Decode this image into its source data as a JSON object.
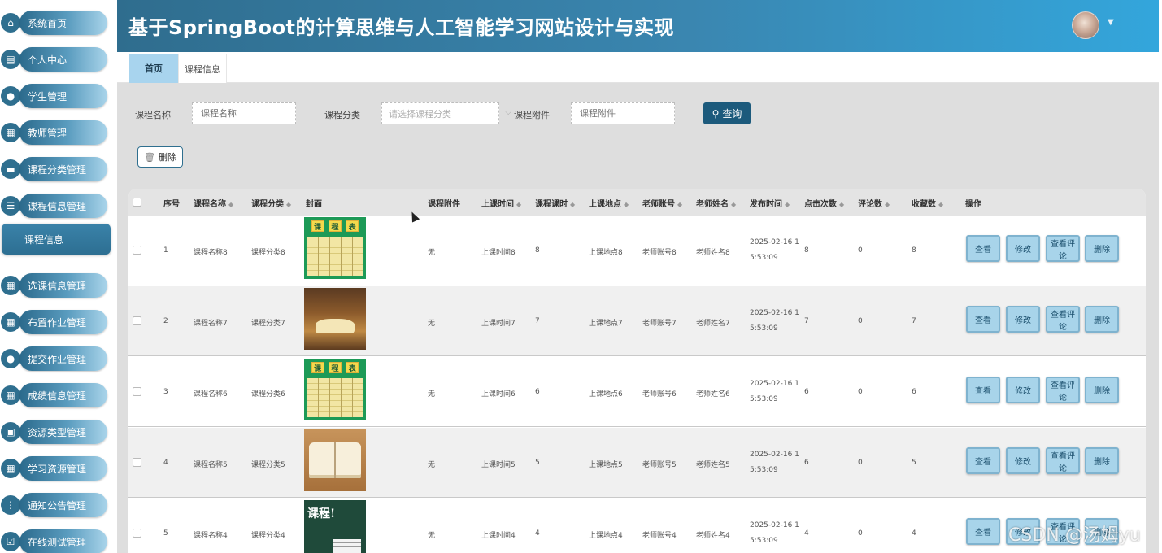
{
  "app": {
    "title": "基于SpringBoot的计算思维与人工智能学习网站设计与实现"
  },
  "sidebar": {
    "items": [
      {
        "label": "系统首页",
        "icon": "home-icon"
      },
      {
        "label": "个人中心",
        "icon": "profile-icon"
      },
      {
        "label": "学生管理",
        "icon": "user-icon"
      },
      {
        "label": "教师管理",
        "icon": "grid-icon"
      },
      {
        "label": "课程分类管理",
        "icon": "ticket-icon"
      },
      {
        "label": "课程信息管理",
        "icon": "list-icon"
      },
      {
        "label": "选课信息管理",
        "icon": "grid-icon"
      },
      {
        "label": "布置作业管理",
        "icon": "grid-icon"
      },
      {
        "label": "提交作业管理",
        "icon": "user-icon"
      },
      {
        "label": "成绩信息管理",
        "icon": "grid-icon"
      },
      {
        "label": "资源类型管理",
        "icon": "briefcase-icon"
      },
      {
        "label": "学习资源管理",
        "icon": "grid-icon"
      },
      {
        "label": "通知公告管理",
        "icon": "dots-icon"
      },
      {
        "label": "在线测试管理",
        "icon": "check-icon"
      }
    ],
    "sub_item": "课程信息"
  },
  "tabs": [
    {
      "label": "首页",
      "active": true
    },
    {
      "label": "课程信息",
      "active": false
    }
  ],
  "search": {
    "name_label": "课程名称",
    "name_placeholder": "课程名称",
    "category_label": "课程分类",
    "category_placeholder": "请选择课程分类",
    "attachment_label": "课程附件",
    "attachment_placeholder": "课程附件",
    "query_label": "查询"
  },
  "toolbar": {
    "delete_label": "删除"
  },
  "table": {
    "headers": [
      "序号",
      "课程名称",
      "课程分类",
      "封面",
      "课程附件",
      "上课时间",
      "课程课时",
      "上课地点",
      "老师账号",
      "老师姓名",
      "发布时间",
      "点击次数",
      "评论数",
      "收藏数",
      "操作"
    ],
    "rows": [
      {
        "index": "1",
        "name": "课程名称8",
        "category": "课程分类8",
        "cover": "grid",
        "attachment": "无",
        "time": "上课时间8",
        "hours": "8",
        "place": "上课地点8",
        "account": "老师账号8",
        "teacher": "老师姓名8",
        "published": "2025-02-16 15:53:09",
        "clicks": "8",
        "comments": "0",
        "favorites": "8"
      },
      {
        "index": "2",
        "name": "课程名称7",
        "category": "课程分类7",
        "cover": "books",
        "attachment": "无",
        "time": "上课时间7",
        "hours": "7",
        "place": "上课地点7",
        "account": "老师账号7",
        "teacher": "老师姓名7",
        "published": "2025-02-16 15:53:09",
        "clicks": "7",
        "comments": "0",
        "favorites": "7"
      },
      {
        "index": "3",
        "name": "课程名称6",
        "category": "课程分类6",
        "cover": "grid",
        "attachment": "无",
        "time": "上课时间6",
        "hours": "6",
        "place": "上课地点6",
        "account": "老师账号6",
        "teacher": "老师姓名6",
        "published": "2025-02-16 15:53:09",
        "clicks": "6",
        "comments": "0",
        "favorites": "6"
      },
      {
        "index": "4",
        "name": "课程名称5",
        "category": "课程分类5",
        "cover": "open",
        "attachment": "无",
        "time": "上课时间5",
        "hours": "5",
        "place": "上课地点5",
        "account": "老师账号5",
        "teacher": "老师姓名5",
        "published": "2025-02-16 15:53:09",
        "clicks": "6",
        "comments": "0",
        "favorites": "5"
      },
      {
        "index": "5",
        "name": "课程名称4",
        "category": "课程分类4",
        "cover": "board",
        "attachment": "无",
        "time": "上课时间4",
        "hours": "4",
        "place": "上课地点4",
        "account": "老师账号4",
        "teacher": "老师姓名4",
        "published": "2025-02-16 15:53:09",
        "clicks": "4",
        "comments": "0",
        "favorites": "4"
      }
    ],
    "actions": [
      "查看",
      "修改",
      "查看评论",
      "删除"
    ]
  },
  "covers": {
    "grid_text": [
      "课",
      "程",
      "表"
    ],
    "board_text": "课程!"
  },
  "watermark": "CSDN @汤姆yu",
  "colors": {
    "header_start": "#2f6d8e",
    "header_end": "#33a6dc",
    "accent": "#1c5a7c",
    "action_button": "#a8d4ea",
    "tab_active": "#a8d4ee"
  }
}
